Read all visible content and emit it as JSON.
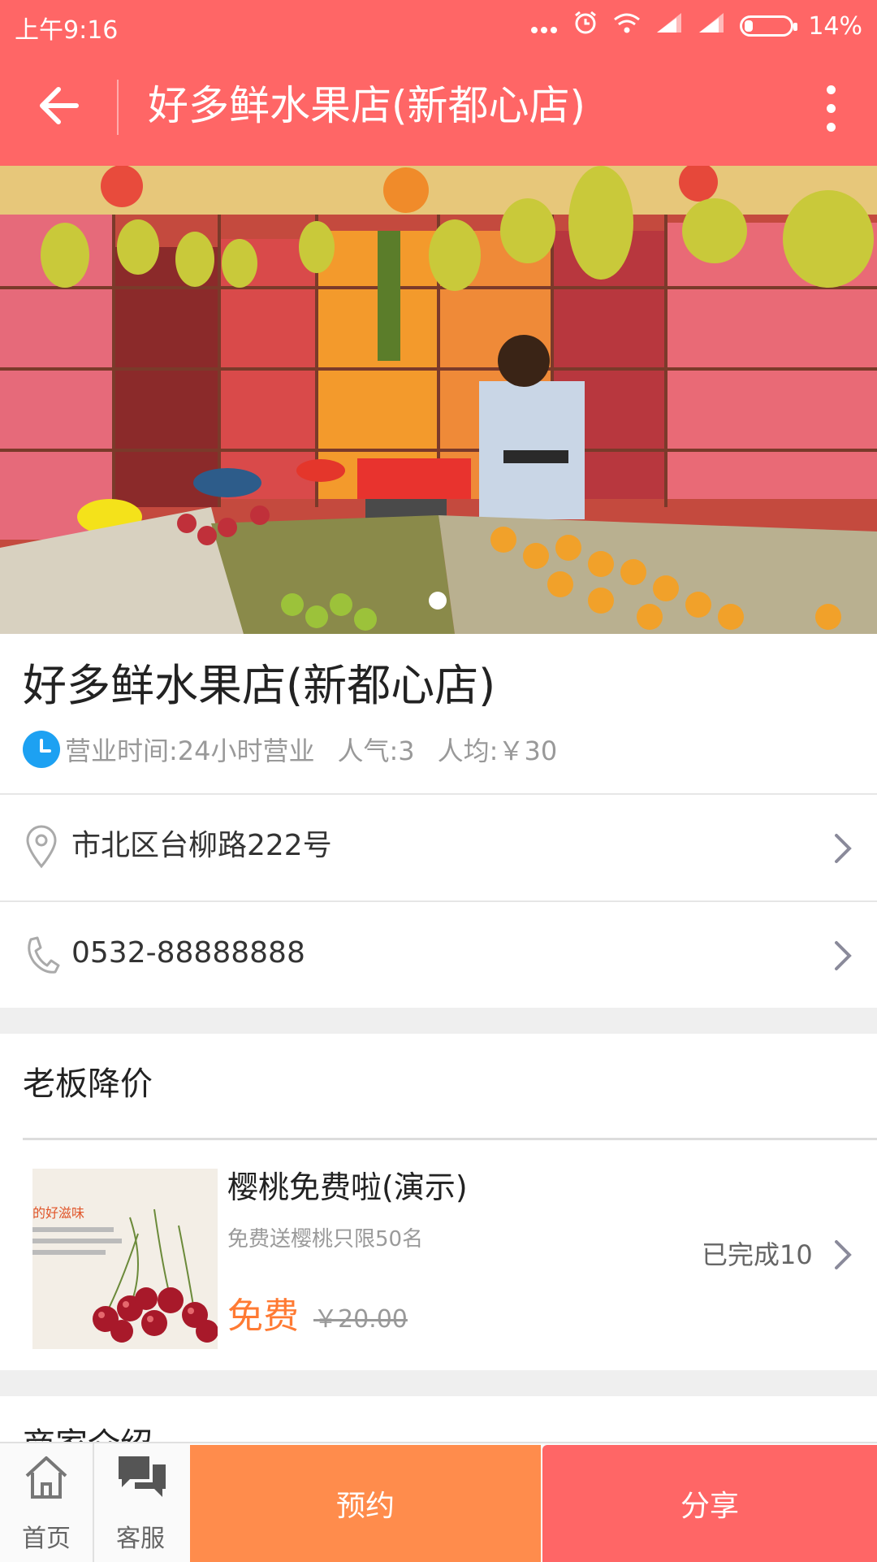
{
  "status_bar": {
    "time": "上午9:16",
    "battery": "14%"
  },
  "appbar": {
    "title": "好多鲜水果店(新都心店)"
  },
  "shop": {
    "name": "好多鲜水果店(新都心店)",
    "hours": "营业时间:24小时营业",
    "popularity": "人气:3",
    "avg_price": "人均:￥30",
    "address": "市北区台柳路222号",
    "phone": "0532-88888888"
  },
  "section": {
    "title": "老板降价"
  },
  "deal": {
    "image_caption": "的好滋味",
    "title": "樱桃免费啦(演示)",
    "desc": "免费送樱桃只限50名",
    "price": "免费",
    "old_price": "￥20.00",
    "done": "已完成10"
  },
  "next_section": {
    "title": "商家介绍"
  },
  "bottom": {
    "home_label": "首页",
    "service_label": "客服",
    "book_label": "预约",
    "share_label": "分享"
  },
  "colors": {
    "brand": "#ff6666",
    "orange": "#ff8c4c",
    "price": "#ff7a33",
    "clock": "#1da1f2"
  }
}
